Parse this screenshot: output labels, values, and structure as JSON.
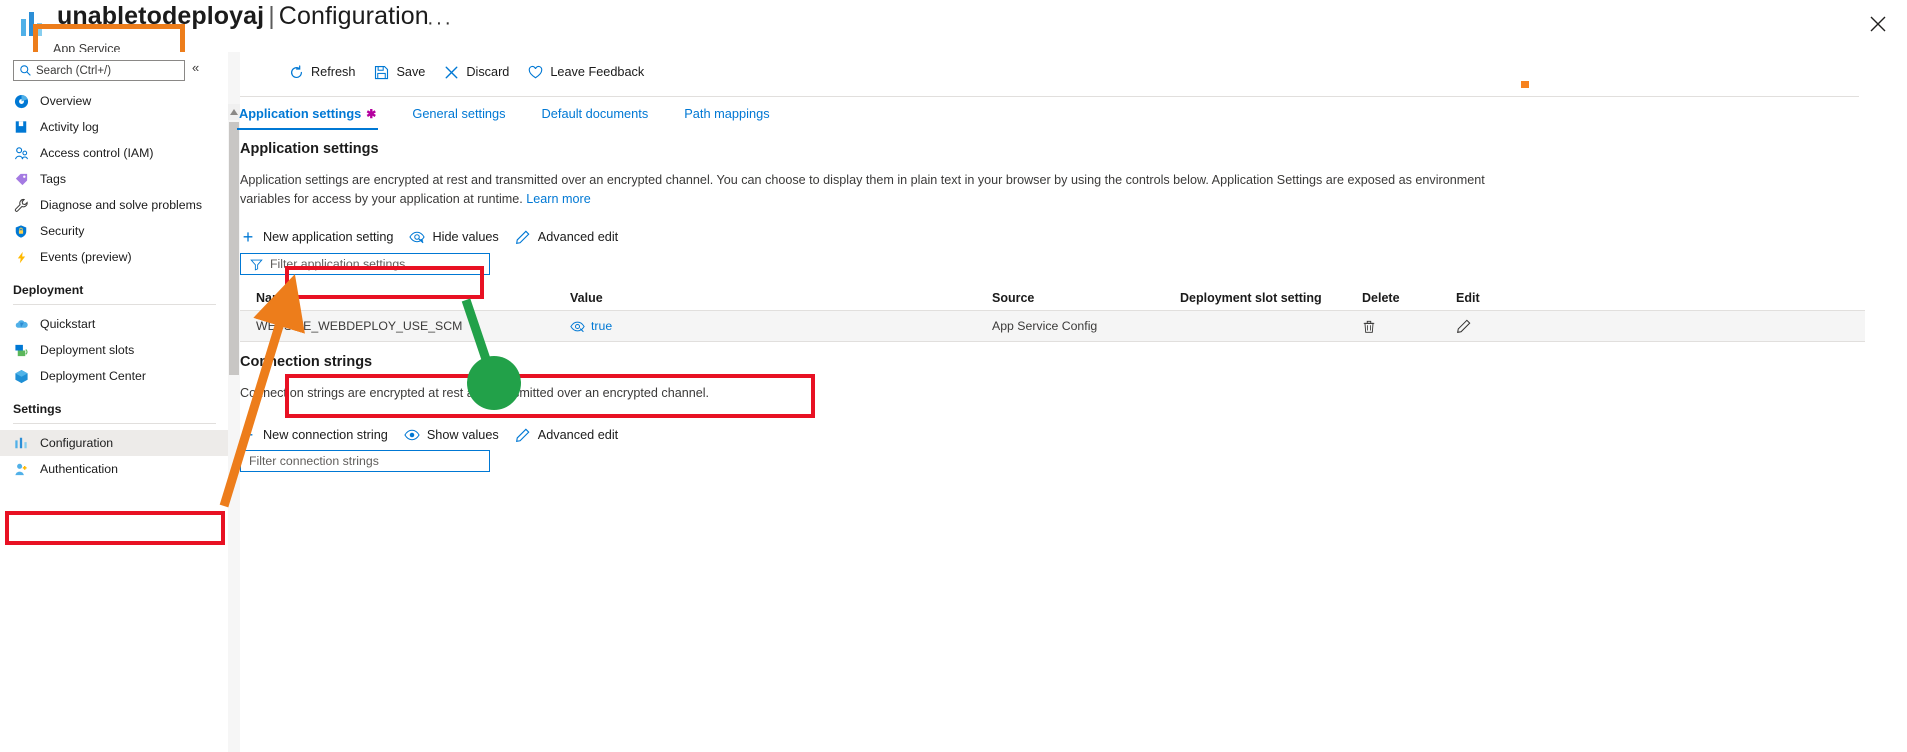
{
  "header": {
    "resource_name": "unabletodeployaj",
    "separator": "|",
    "page": "Configuration",
    "ellipsis": "···",
    "subtitle": "App Service",
    "close_label": "Close"
  },
  "sidebar": {
    "search_placeholder": "Search (Ctrl+/)",
    "collapse_label": "«",
    "items": [
      {
        "label": "Overview",
        "icon": "overview-icon"
      },
      {
        "label": "Activity log",
        "icon": "activity-log-icon"
      },
      {
        "label": "Access control (IAM)",
        "icon": "access-control-icon"
      },
      {
        "label": "Tags",
        "icon": "tags-icon"
      },
      {
        "label": "Diagnose and solve problems",
        "icon": "wrench-icon"
      },
      {
        "label": "Security",
        "icon": "shield-icon"
      },
      {
        "label": "Events (preview)",
        "icon": "lightning-icon"
      }
    ],
    "groups": [
      {
        "label": "Deployment",
        "items": [
          {
            "label": "Quickstart",
            "icon": "cloud-icon"
          },
          {
            "label": "Deployment slots",
            "icon": "slots-icon"
          },
          {
            "label": "Deployment Center",
            "icon": "cube-icon"
          }
        ]
      },
      {
        "label": "Settings",
        "items": [
          {
            "label": "Configuration",
            "icon": "configuration-icon",
            "selected": true
          },
          {
            "label": "Authentication",
            "icon": "authentication-icon"
          }
        ]
      }
    ]
  },
  "toolbar": {
    "commands": [
      {
        "label": "Refresh",
        "icon": "refresh-icon"
      },
      {
        "label": "Save",
        "icon": "save-icon"
      },
      {
        "label": "Discard",
        "icon": "discard-icon"
      },
      {
        "label": "Leave Feedback",
        "icon": "heart-icon"
      }
    ]
  },
  "tabs": [
    {
      "label": "Application settings",
      "dirty": "✱",
      "active": true
    },
    {
      "label": "General settings",
      "active": false
    },
    {
      "label": "Default documents",
      "active": false
    },
    {
      "label": "Path mappings",
      "active": false
    }
  ],
  "app_settings": {
    "title": "Application settings",
    "description": "Application settings are encrypted at rest and transmitted over an encrypted channel. You can choose to display them in plain text in your browser by using the controls below. Application Settings are exposed as environment variables for access by your application at runtime.",
    "learn_more": "Learn more",
    "actions": [
      {
        "label": "New application setting",
        "icon": "plus-icon"
      },
      {
        "label": "Hide values",
        "icon": "hide-values-icon"
      },
      {
        "label": "Advanced edit",
        "icon": "pencil-icon"
      }
    ],
    "filter_placeholder": "Filter application settings",
    "columns": [
      "Name",
      "Value",
      "Source",
      "Deployment slot setting",
      "Delete",
      "Edit"
    ],
    "rows": [
      {
        "name": "WEBSITE_WEBDEPLOY_USE_SCM",
        "value": "true",
        "source": "App Service Config",
        "slot_setting": "",
        "delete_icon": "trash-icon",
        "edit_icon": "pencil-icon"
      }
    ]
  },
  "connection_strings": {
    "title": "Connection strings",
    "description": "Connection strings are encrypted at rest and transmitted over an encrypted channel.",
    "actions": [
      {
        "label": "New connection string",
        "icon": "plus-icon"
      },
      {
        "label": "Show values",
        "icon": "eye-icon"
      },
      {
        "label": "Advanced edit",
        "icon": "pencil-icon"
      }
    ],
    "filter_placeholder": "Filter connection strings"
  },
  "annotations": {
    "red": "#E81123",
    "orange": "#ED7D1B",
    "green": "#22A149",
    "marker_color": "#F7821E"
  }
}
